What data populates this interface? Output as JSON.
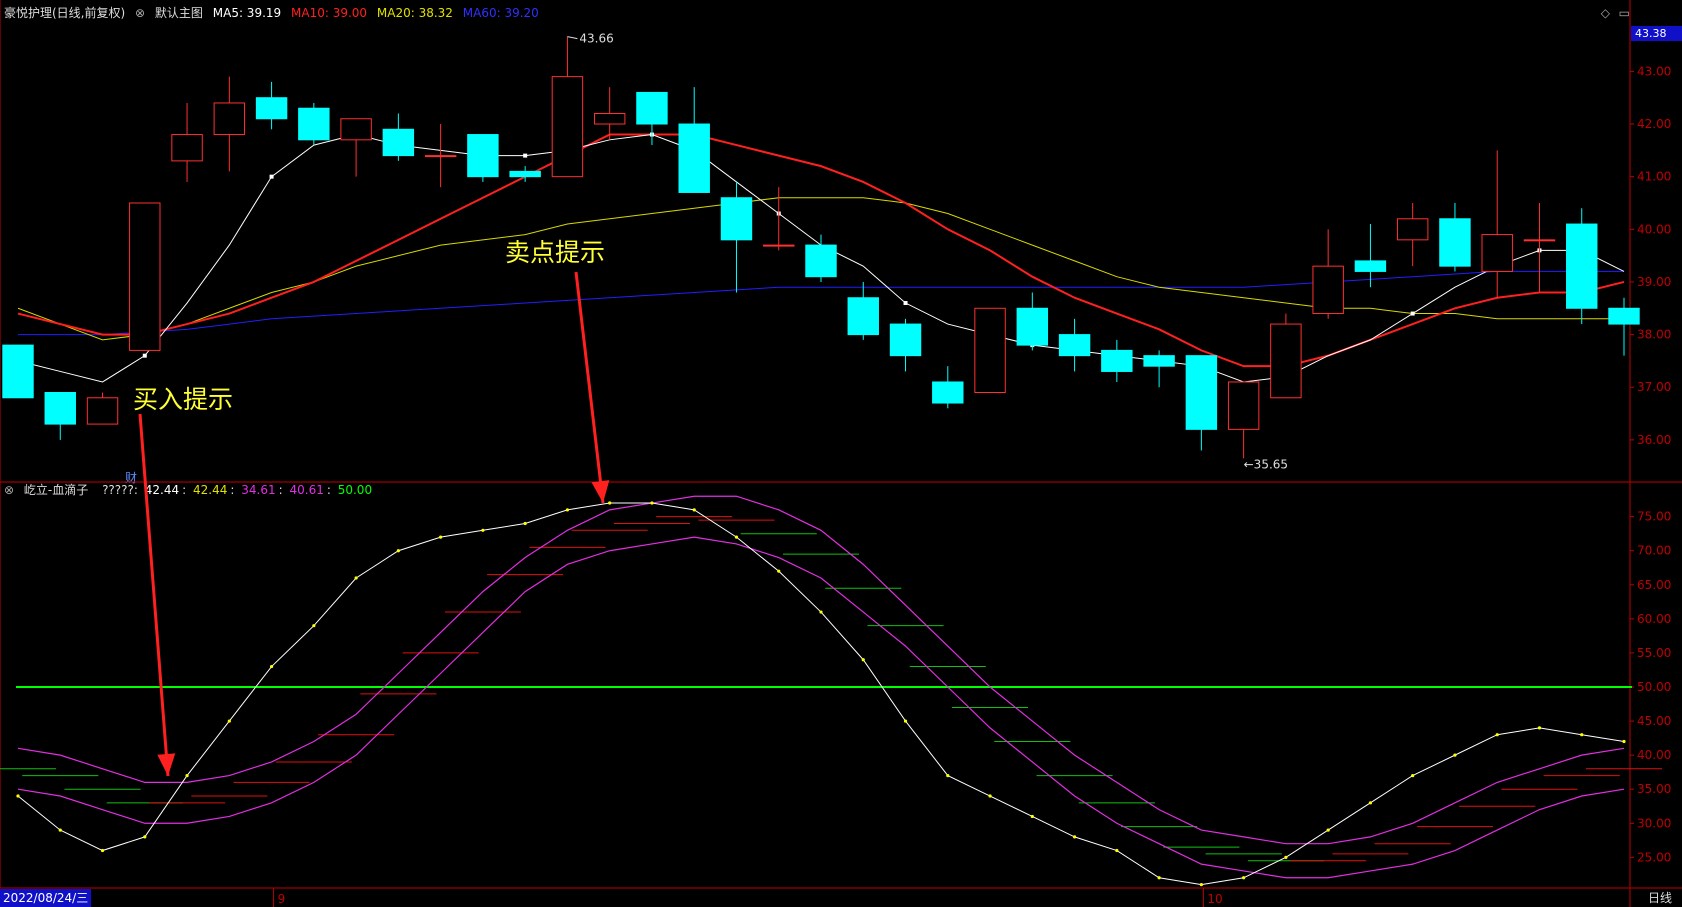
{
  "main_header": {
    "stock_title": "豪悦护理(日线,前复权)",
    "chart_name": "默认主图",
    "ma5_label": "MA5: 39.19",
    "ma10_label": "MA10: 39.00",
    "ma20_label": "MA20: 38.32",
    "ma60_label": "MA60: 39.20"
  },
  "sub_header": {
    "indicator_title": "屹立-血滴子",
    "value_prefix": "?????:",
    "v1": "42.44",
    "v2": "42.44",
    "v3": "34.61",
    "v4": "40.61",
    "v5": "50.00"
  },
  "current_price": "43.38",
  "annotations": {
    "sell_hint": "卖点提示",
    "buy_hint": "买入提示",
    "high_label": "43.66",
    "low_label": "←35.65",
    "finance_marker": "财"
  },
  "bottom_bar": {
    "date_box": "2022/08/24/三",
    "month_9": "9",
    "month_10": "10",
    "period": "日线"
  },
  "colors": {
    "ma5": "#ffffff",
    "ma10": "#ff2020",
    "ma20": "#d8d800",
    "ma60": "#2020ff",
    "up_candle": "#ff3030",
    "down_candle": "#00ffff",
    "sub_white": "#ffffff",
    "sub_magenta": "#e030e0",
    "level50": "#00ff00",
    "axis": "#c00000"
  },
  "chart_data": [
    {
      "type": "candlestick",
      "ylim": [
        35.2,
        43.9
      ],
      "yticks": [
        "43.00",
        "42.00",
        "41.00",
        "40.00",
        "39.00",
        "38.00",
        "37.00",
        "36.00"
      ],
      "candles": [
        {
          "o": 37.8,
          "c": 36.8,
          "h": 37.8,
          "l": 36.8
        },
        {
          "o": 36.9,
          "c": 36.3,
          "h": 36.9,
          "l": 36.0
        },
        {
          "o": 36.3,
          "c": 36.8,
          "h": 36.9,
          "l": 36.3
        },
        {
          "o": 37.7,
          "c": 40.5,
          "h": 40.5,
          "l": 37.7
        },
        {
          "o": 41.3,
          "c": 41.8,
          "h": 42.4,
          "l": 40.9
        },
        {
          "o": 41.8,
          "c": 42.4,
          "h": 42.9,
          "l": 41.1
        },
        {
          "o": 42.5,
          "c": 42.1,
          "h": 42.8,
          "l": 41.9
        },
        {
          "o": 42.3,
          "c": 41.7,
          "h": 42.4,
          "l": 41.6
        },
        {
          "o": 41.7,
          "c": 42.1,
          "h": 42.1,
          "l": 41.0
        },
        {
          "o": 41.9,
          "c": 41.4,
          "h": 42.2,
          "l": 41.3
        },
        {
          "o": 41.4,
          "c": 41.4,
          "h": 42.0,
          "l": 40.8
        },
        {
          "o": 41.8,
          "c": 41.0,
          "h": 41.8,
          "l": 40.9
        },
        {
          "o": 41.1,
          "c": 41.0,
          "h": 41.2,
          "l": 40.9
        },
        {
          "o": 41.0,
          "c": 42.9,
          "h": 43.66,
          "l": 41.0
        },
        {
          "o": 42.0,
          "c": 42.2,
          "h": 42.7,
          "l": 41.7
        },
        {
          "o": 42.6,
          "c": 42.0,
          "h": 42.6,
          "l": 41.6
        },
        {
          "o": 42.0,
          "c": 40.7,
          "h": 42.7,
          "l": 40.7
        },
        {
          "o": 40.6,
          "c": 39.8,
          "h": 40.9,
          "l": 38.8
        },
        {
          "o": 39.7,
          "c": 39.7,
          "h": 40.8,
          "l": 39.6
        },
        {
          "o": 39.7,
          "c": 39.1,
          "h": 39.9,
          "l": 39.0
        },
        {
          "o": 38.7,
          "c": 38.0,
          "h": 39.0,
          "l": 37.9
        },
        {
          "o": 38.2,
          "c": 37.6,
          "h": 38.3,
          "l": 37.3
        },
        {
          "o": 37.1,
          "c": 36.7,
          "h": 37.4,
          "l": 36.6
        },
        {
          "o": 36.9,
          "c": 38.5,
          "h": 38.5,
          "l": 36.9
        },
        {
          "o": 38.5,
          "c": 37.8,
          "h": 38.8,
          "l": 37.7
        },
        {
          "o": 38.0,
          "c": 37.6,
          "h": 38.3,
          "l": 37.3
        },
        {
          "o": 37.7,
          "c": 37.3,
          "h": 37.9,
          "l": 37.1
        },
        {
          "o": 37.6,
          "c": 37.4,
          "h": 37.7,
          "l": 37.0
        },
        {
          "o": 37.6,
          "c": 36.2,
          "h": 37.6,
          "l": 35.8
        },
        {
          "o": 36.2,
          "c": 37.1,
          "h": 37.1,
          "l": 35.65
        },
        {
          "o": 36.8,
          "c": 38.2,
          "h": 38.4,
          "l": 36.8
        },
        {
          "o": 38.4,
          "c": 39.3,
          "h": 40.0,
          "l": 38.3
        },
        {
          "o": 39.4,
          "c": 39.2,
          "h": 40.1,
          "l": 38.9
        },
        {
          "o": 39.8,
          "c": 40.2,
          "h": 40.5,
          "l": 39.3
        },
        {
          "o": 40.2,
          "c": 39.3,
          "h": 40.5,
          "l": 39.2
        },
        {
          "o": 39.2,
          "c": 39.9,
          "h": 41.5,
          "l": 38.7
        },
        {
          "o": 39.8,
          "c": 39.8,
          "h": 40.5,
          "l": 38.8
        },
        {
          "o": 40.1,
          "c": 38.5,
          "h": 40.4,
          "l": 38.2
        },
        {
          "o": 38.5,
          "c": 38.2,
          "h": 38.7,
          "l": 37.6
        }
      ],
      "series": [
        {
          "name": "MA5",
          "values": [
            37.5,
            37.3,
            37.1,
            37.6,
            38.6,
            39.7,
            41.0,
            41.6,
            41.8,
            41.6,
            41.5,
            41.4,
            41.4,
            41.5,
            41.7,
            41.8,
            41.5,
            40.9,
            40.3,
            39.7,
            39.3,
            38.6,
            38.2,
            38.0,
            37.8,
            37.7,
            37.6,
            37.5,
            37.4,
            37.1,
            37.2,
            37.6,
            37.9,
            38.4,
            38.9,
            39.3,
            39.6,
            39.6,
            39.2
          ]
        },
        {
          "name": "MA10",
          "values": [
            38.4,
            38.2,
            38.0,
            38.0,
            38.2,
            38.4,
            38.7,
            39.0,
            39.4,
            39.8,
            40.2,
            40.6,
            41.0,
            41.4,
            41.8,
            41.8,
            41.8,
            41.6,
            41.4,
            41.2,
            40.9,
            40.5,
            40.0,
            39.6,
            39.1,
            38.7,
            38.4,
            38.1,
            37.7,
            37.4,
            37.4,
            37.6,
            37.9,
            38.2,
            38.5,
            38.7,
            38.8,
            38.8,
            39.0
          ]
        },
        {
          "name": "MA20",
          "values": [
            38.5,
            38.2,
            37.9,
            38.0,
            38.2,
            38.5,
            38.8,
            39.0,
            39.3,
            39.5,
            39.7,
            39.8,
            39.9,
            40.1,
            40.2,
            40.3,
            40.4,
            40.5,
            40.6,
            40.6,
            40.6,
            40.5,
            40.3,
            40.0,
            39.7,
            39.4,
            39.1,
            38.9,
            38.8,
            38.7,
            38.6,
            38.5,
            38.5,
            38.4,
            38.4,
            38.3,
            38.3,
            38.3,
            38.3
          ]
        },
        {
          "name": "MA60",
          "values": [
            38.0,
            38.0,
            38.0,
            38.05,
            38.1,
            38.2,
            38.3,
            38.35,
            38.4,
            38.45,
            38.5,
            38.55,
            38.6,
            38.65,
            38.7,
            38.75,
            38.8,
            38.85,
            38.9,
            38.9,
            38.9,
            38.9,
            38.9,
            38.9,
            38.9,
            38.9,
            38.9,
            38.9,
            38.9,
            38.9,
            38.95,
            39.0,
            39.05,
            39.1,
            39.15,
            39.2,
            39.2,
            39.2,
            39.2
          ]
        }
      ]
    },
    {
      "type": "line",
      "ylim": [
        20.5,
        79.5
      ],
      "yticks": [
        "75.00",
        "70.00",
        "65.00",
        "60.00",
        "55.00",
        "50.00",
        "45.00",
        "40.00",
        "35.00",
        "30.00",
        "25.00"
      ],
      "series": [
        {
          "name": "white",
          "values": [
            34,
            29,
            26,
            28,
            37,
            45,
            53,
            59,
            66,
            70,
            72,
            73,
            74,
            76,
            77,
            77,
            76,
            72,
            67,
            61,
            54,
            45,
            37,
            34,
            31,
            28,
            26,
            22,
            21,
            22,
            25,
            29,
            33,
            37,
            40,
            43,
            44,
            43,
            42
          ]
        },
        {
          "name": "magenta_upper",
          "values": [
            41,
            40,
            38,
            36,
            36,
            37,
            39,
            42,
            46,
            52,
            58,
            64,
            69,
            73,
            76,
            77,
            78,
            78,
            76,
            73,
            68,
            62,
            56,
            50,
            45,
            40,
            36,
            32,
            29,
            28,
            27,
            27,
            28,
            30,
            33,
            36,
            38,
            40,
            41
          ]
        },
        {
          "name": "magenta_lower",
          "values": [
            35,
            34,
            32,
            30,
            30,
            31,
            33,
            36,
            40,
            46,
            52,
            58,
            64,
            68,
            70,
            71,
            72,
            71,
            69,
            66,
            61,
            56,
            50,
            44,
            39,
            34,
            30,
            27,
            24,
            23,
            22,
            22,
            23,
            24,
            26,
            29,
            32,
            34,
            35
          ]
        }
      ],
      "level": 50
    }
  ]
}
